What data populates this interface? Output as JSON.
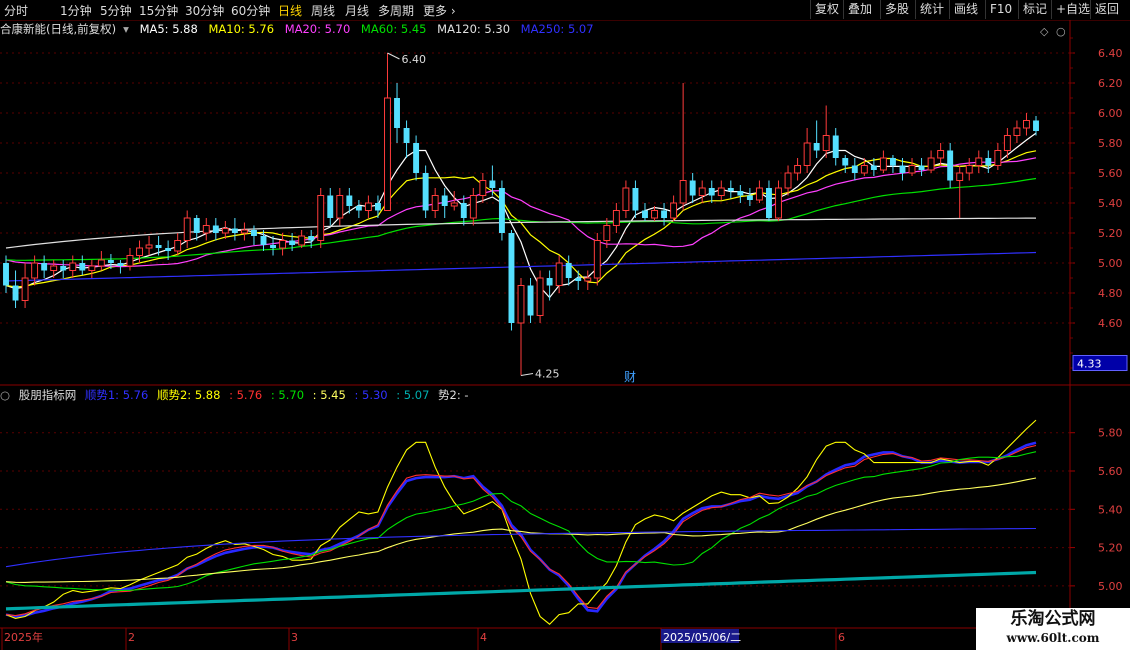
{
  "toolbar": {
    "timeframes": [
      "分时",
      "1分钟",
      "5分钟",
      "15分钟",
      "30分钟",
      "60分钟",
      "日线",
      "周线",
      "月线",
      "多周期",
      "更多"
    ],
    "active": "日线",
    "right_buttons": [
      "复权",
      "叠加",
      "多股",
      "统计",
      "画线",
      "F10",
      "标记",
      "+自选",
      "返回"
    ]
  },
  "main_header": {
    "title": "合康新能(日线,前复权)",
    "ma": [
      {
        "label": "MA5: 5.88",
        "color": "#ffffff"
      },
      {
        "label": "MA10: 5.76",
        "color": "#ffff00"
      },
      {
        "label": "MA20: 5.70",
        "color": "#ff40ff"
      },
      {
        "label": "MA60: 5.45",
        "color": "#00e000"
      },
      {
        "label": "MA120: 5.30",
        "color": "#e0e0e0"
      },
      {
        "label": "MA250: 5.07",
        "color": "#3030ff"
      }
    ]
  },
  "indicator_header": {
    "title": "股朋指标网",
    "items": [
      {
        "label": "顺势1: 5.76",
        "color": "#3030ff"
      },
      {
        "label": "顺势2: 5.88",
        "color": "#ffff00"
      },
      {
        "label": ": 5.76",
        "color": "#ff3030"
      },
      {
        "label": ": 5.70",
        "color": "#00e000"
      },
      {
        "label": ": 5.45",
        "color": "#ffff60"
      },
      {
        "label": ": 5.30",
        "color": "#3030ff"
      },
      {
        "label": ": 5.07",
        "color": "#00b0b0"
      },
      {
        "label": "势2: -",
        "color": "#dddddd"
      }
    ]
  },
  "annotations": {
    "high": "6.40",
    "low": "4.25",
    "fin": "财",
    "price_box": "4.33"
  },
  "date_axis": {
    "labels": [
      "2025年",
      "2",
      "3",
      "4",
      "2025/05/06/二",
      "6"
    ]
  },
  "watermark": {
    "line1": "乐淘公式网",
    "line2": "www.60lt.com"
  },
  "chart_data": [
    {
      "type": "candlestick",
      "title": "合康新能(日线,前复权)",
      "ylim": [
        4.2,
        6.5
      ],
      "yticks": [
        4.6,
        4.8,
        5.0,
        5.2,
        5.4,
        5.6,
        5.8,
        6.0,
        6.2,
        6.4
      ],
      "candles": [
        [
          5.0,
          4.85,
          5.05,
          4.8
        ],
        [
          4.85,
          4.75,
          4.95,
          4.7
        ],
        [
          4.75,
          4.9,
          5.0,
          4.7
        ],
        [
          4.9,
          5.0,
          5.05,
          4.85
        ],
        [
          5.0,
          4.95,
          5.05,
          4.9
        ],
        [
          4.95,
          4.98,
          5.02,
          4.9
        ],
        [
          4.98,
          4.95,
          5.02,
          4.9
        ],
        [
          4.95,
          5.0,
          5.05,
          4.9
        ],
        [
          5.0,
          4.95,
          5.05,
          4.92
        ],
        [
          4.95,
          4.98,
          5.02,
          4.9
        ],
        [
          4.98,
          5.02,
          5.08,
          4.95
        ],
        [
          5.02,
          5.0,
          5.06,
          4.96
        ],
        [
          5.0,
          4.98,
          5.02,
          4.93
        ],
        [
          4.98,
          5.05,
          5.1,
          4.95
        ],
        [
          5.05,
          5.1,
          5.15,
          5.0
        ],
        [
          5.1,
          5.12,
          5.18,
          5.05
        ],
        [
          5.12,
          5.1,
          5.18,
          5.05
        ],
        [
          5.1,
          5.08,
          5.15,
          5.02
        ],
        [
          5.08,
          5.15,
          5.2,
          5.05
        ],
        [
          5.15,
          5.3,
          5.35,
          5.1
        ],
        [
          5.3,
          5.2,
          5.32,
          5.15
        ],
        [
          5.2,
          5.25,
          5.3,
          5.15
        ],
        [
          5.25,
          5.2,
          5.3,
          5.15
        ],
        [
          5.2,
          5.23,
          5.28,
          5.16
        ],
        [
          5.23,
          5.2,
          5.3,
          5.15
        ],
        [
          5.2,
          5.22,
          5.27,
          5.15
        ],
        [
          5.22,
          5.18,
          5.25,
          5.12
        ],
        [
          5.18,
          5.12,
          5.22,
          5.08
        ],
        [
          5.12,
          5.1,
          5.18,
          5.05
        ],
        [
          5.1,
          5.15,
          5.2,
          5.05
        ],
        [
          5.15,
          5.12,
          5.2,
          5.08
        ],
        [
          5.12,
          5.18,
          5.22,
          5.1
        ],
        [
          5.18,
          5.15,
          5.22,
          5.1
        ],
        [
          5.15,
          5.45,
          5.5,
          5.1
        ],
        [
          5.45,
          5.3,
          5.5,
          5.25
        ],
        [
          5.3,
          5.45,
          5.5,
          5.25
        ],
        [
          5.45,
          5.38,
          5.5,
          5.33
        ],
        [
          5.38,
          5.35,
          5.42,
          5.3
        ],
        [
          5.35,
          5.4,
          5.45,
          5.3
        ],
        [
          5.4,
          5.35,
          5.45,
          5.3
        ],
        [
          5.35,
          6.1,
          6.4,
          5.35
        ],
        [
          6.1,
          5.9,
          6.2,
          5.8
        ],
        [
          5.9,
          5.8,
          5.95,
          5.7
        ],
        [
          5.8,
          5.6,
          5.85,
          5.55
        ],
        [
          5.6,
          5.35,
          5.65,
          5.3
        ],
        [
          5.35,
          5.45,
          5.5,
          5.3
        ],
        [
          5.45,
          5.38,
          5.5,
          5.3
        ],
        [
          5.38,
          5.4,
          5.48,
          5.35
        ],
        [
          5.4,
          5.3,
          5.45,
          5.25
        ],
        [
          5.3,
          5.45,
          5.5,
          5.25
        ],
        [
          5.45,
          5.55,
          5.6,
          5.4
        ],
        [
          5.55,
          5.5,
          5.65,
          5.45
        ],
        [
          5.5,
          5.2,
          5.55,
          5.15
        ],
        [
          5.2,
          4.6,
          5.22,
          4.55
        ],
        [
          4.6,
          4.85,
          4.9,
          4.25
        ],
        [
          4.85,
          4.65,
          4.9,
          4.6
        ],
        [
          4.65,
          4.9,
          4.95,
          4.6
        ],
        [
          4.9,
          4.85,
          4.95,
          4.75
        ],
        [
          4.85,
          5.0,
          5.05,
          4.8
        ],
        [
          5.0,
          4.9,
          5.05,
          4.85
        ],
        [
          4.9,
          4.88,
          4.95,
          4.82
        ],
        [
          4.88,
          4.9,
          4.95,
          4.82
        ],
        [
          4.9,
          5.15,
          5.2,
          4.85
        ],
        [
          5.15,
          5.25,
          5.3,
          5.1
        ],
        [
          5.25,
          5.35,
          5.4,
          5.2
        ],
        [
          5.35,
          5.5,
          5.55,
          5.3
        ],
        [
          5.5,
          5.35,
          5.55,
          5.3
        ],
        [
          5.35,
          5.3,
          5.4,
          5.28
        ],
        [
          5.3,
          5.35,
          5.38,
          5.28
        ],
        [
          5.35,
          5.3,
          5.4,
          5.25
        ],
        [
          5.3,
          5.4,
          5.45,
          5.28
        ],
        [
          5.4,
          5.55,
          6.2,
          5.35
        ],
        [
          5.55,
          5.45,
          5.6,
          5.4
        ],
        [
          5.45,
          5.5,
          5.55,
          5.4
        ],
        [
          5.5,
          5.45,
          5.55,
          5.4
        ],
        [
          5.45,
          5.5,
          5.55,
          5.42
        ],
        [
          5.5,
          5.48,
          5.55,
          5.43
        ],
        [
          5.48,
          5.45,
          5.52,
          5.4
        ],
        [
          5.45,
          5.42,
          5.5,
          5.38
        ],
        [
          5.42,
          5.5,
          5.55,
          5.4
        ],
        [
          5.5,
          5.3,
          5.55,
          5.28
        ],
        [
          5.3,
          5.5,
          5.55,
          5.28
        ],
        [
          5.5,
          5.6,
          5.65,
          5.45
        ],
        [
          5.6,
          5.65,
          5.7,
          5.55
        ],
        [
          5.65,
          5.8,
          5.9,
          5.6
        ],
        [
          5.8,
          5.75,
          5.95,
          5.7
        ],
        [
          5.75,
          5.85,
          6.05,
          5.7
        ],
        [
          5.85,
          5.7,
          5.9,
          5.65
        ],
        [
          5.7,
          5.65,
          5.72,
          5.6
        ],
        [
          5.65,
          5.6,
          5.7,
          5.55
        ],
        [
          5.6,
          5.65,
          5.7,
          5.58
        ],
        [
          5.65,
          5.62,
          5.7,
          5.58
        ],
        [
          5.62,
          5.7,
          5.75,
          5.6
        ],
        [
          5.7,
          5.65,
          5.72,
          5.6
        ],
        [
          5.65,
          5.6,
          5.7,
          5.55
        ],
        [
          5.6,
          5.65,
          5.7,
          5.58
        ],
        [
          5.65,
          5.62,
          5.7,
          5.58
        ],
        [
          5.62,
          5.7,
          5.75,
          5.6
        ],
        [
          5.7,
          5.75,
          5.8,
          5.65
        ],
        [
          5.75,
          5.55,
          5.8,
          5.5
        ],
        [
          5.55,
          5.6,
          5.65,
          5.3
        ],
        [
          5.6,
          5.65,
          5.7,
          5.55
        ],
        [
          5.65,
          5.7,
          5.75,
          5.6
        ],
        [
          5.7,
          5.65,
          5.75,
          5.6
        ],
        [
          5.65,
          5.75,
          5.8,
          5.62
        ],
        [
          5.75,
          5.85,
          5.9,
          5.7
        ],
        [
          5.85,
          5.9,
          5.95,
          5.8
        ],
        [
          5.9,
          5.95,
          6.0,
          5.85
        ],
        [
          5.95,
          5.88,
          5.98,
          5.85
        ]
      ],
      "ma_series": [
        {
          "name": "MA5",
          "color": "#ffffff",
          "last": 5.88
        },
        {
          "name": "MA10",
          "color": "#ffff00",
          "last": 5.76
        },
        {
          "name": "MA20",
          "color": "#ff40ff",
          "last": 5.7
        },
        {
          "name": "MA60",
          "color": "#00e000",
          "last": 5.45
        },
        {
          "name": "MA120",
          "color": "#e0e0e0",
          "last": 5.3
        },
        {
          "name": "MA250",
          "color": "#3030ff",
          "last": 5.07
        }
      ]
    },
    {
      "type": "line",
      "title": "股朋指标网",
      "ylim": [
        4.78,
        5.95
      ],
      "yticks": [
        5.0,
        5.2,
        5.4,
        5.6,
        5.8
      ],
      "series": [
        {
          "name": "顺势1",
          "color": "#2828ff",
          "last": 5.76
        },
        {
          "name": "顺势2",
          "color": "#ffff00",
          "last": 5.88
        },
        {
          "name": "",
          "color": "#ff3030",
          "last": 5.76
        },
        {
          "name": "",
          "color": "#00e000",
          "last": 5.7
        },
        {
          "name": "",
          "color": "#ffff60",
          "last": 5.45
        },
        {
          "name": "",
          "color": "#3030ff",
          "last": 5.3
        },
        {
          "name": "",
          "color": "#00a8a8",
          "last": 5.07
        }
      ]
    }
  ]
}
